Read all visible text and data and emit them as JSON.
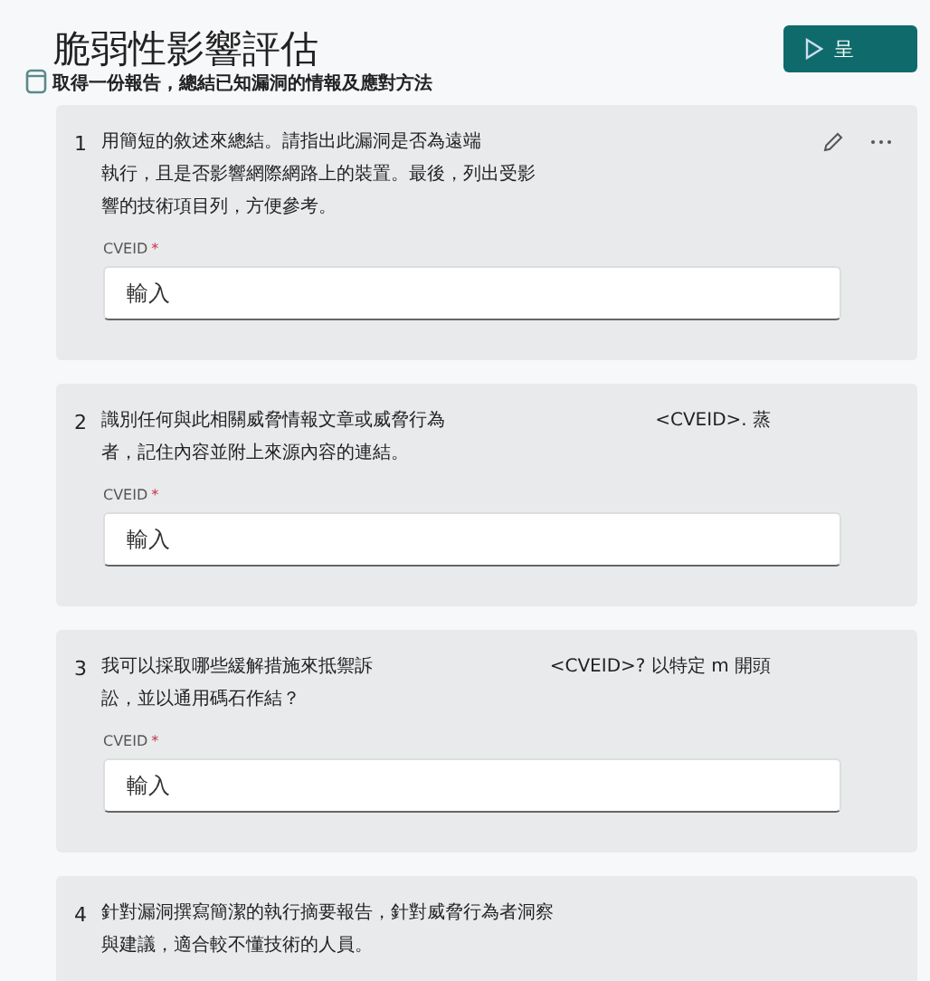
{
  "header": {
    "title": "脆弱性影響評估",
    "subtitle": "取得一份報告，總結已知漏洞的情報及應對方法",
    "run_button": {
      "label": "呈"
    }
  },
  "prompts": [
    {
      "number": "1",
      "lines": [
        [
          "用簡短的敘述來總結。請指出此漏洞是否為遠端"
        ],
        [
          "執行，且是否影響網際網路上的裝置。最後，列出受影"
        ],
        [
          "響的技術項目列，方便參考。"
        ]
      ],
      "editable": true,
      "field": {
        "label": "CVEID",
        "required_mark": "*",
        "placeholder": "輸入"
      }
    },
    {
      "number": "2",
      "lines": [
        [
          "識別任何與此相關威脅情報文章或威脅行為",
          "<CVEID>. 蒸"
        ],
        [
          "者，記住內容並附上來源內容的連結。"
        ]
      ],
      "editable": false,
      "field": {
        "label": "CVEID",
        "required_mark": "*",
        "placeholder": "輸入"
      }
    },
    {
      "number": "3",
      "lines": [
        [
          "我可以採取哪些緩解措施來抵禦訴",
          "<CVEID>? 以特定 m 開頭"
        ],
        [
          "訟，並以通用碼石作結？"
        ]
      ],
      "editable": false,
      "field": {
        "label": "CVEID",
        "required_mark": "*",
        "placeholder": "輸入"
      }
    },
    {
      "number": "4",
      "lines": [
        [
          "針對漏洞撰寫簡潔的執行摘要報告，針對威脅行為者洞察"
        ],
        [
          "與建議，適合較不懂技術的人員。"
        ]
      ],
      "editable": false
    }
  ]
}
